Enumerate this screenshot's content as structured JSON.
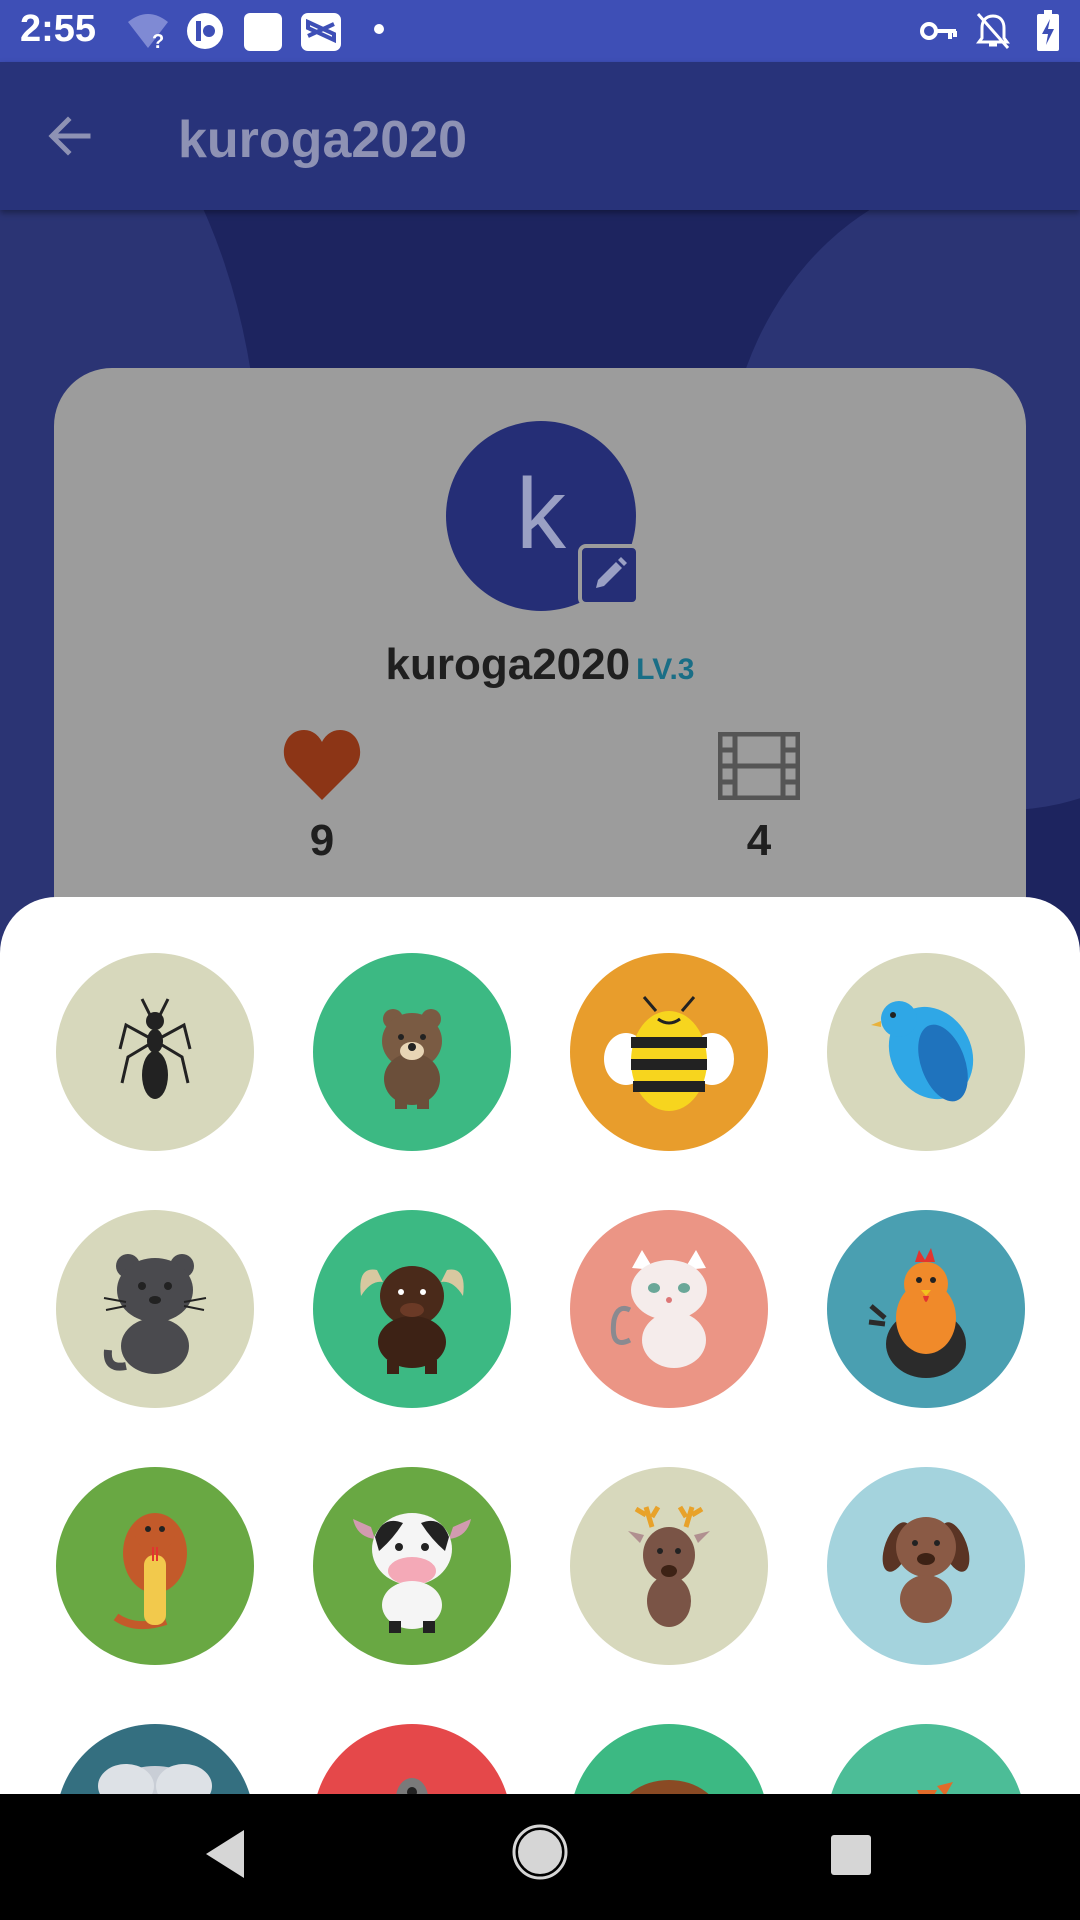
{
  "status_bar": {
    "time": "2:55",
    "left_icons": [
      "wifi-question-icon",
      "app-notification-icon",
      "blank-notification-icon",
      "capcut-notification-icon",
      "dot-icon"
    ],
    "right_icons": [
      "vpn-key-icon",
      "notifications-off-icon",
      "battery-charging-icon"
    ]
  },
  "app_bar": {
    "back_icon": "arrow-back-icon",
    "title": "kuroga2020"
  },
  "profile": {
    "avatar_letter": "k",
    "edit_icon": "pencil-icon",
    "username": "kuroga2020",
    "level": "LV.3",
    "likes": "9",
    "videos": "4",
    "likes_icon": "heart-icon",
    "videos_icon": "film-strip-icon"
  },
  "avatar_choices": [
    {
      "animal": "ant",
      "bg": "#d7d8bc"
    },
    {
      "animal": "bear",
      "bg": "#3cb983"
    },
    {
      "animal": "bee",
      "bg": "#e89d2c"
    },
    {
      "animal": "bird",
      "bg": "#d7d8bc"
    },
    {
      "animal": "panther",
      "bg": "#d7d8bc"
    },
    {
      "animal": "buffalo",
      "bg": "#3cb983"
    },
    {
      "animal": "cat",
      "bg": "#eb9585"
    },
    {
      "animal": "rooster",
      "bg": "#4a9fb1"
    },
    {
      "animal": "cobra",
      "bg": "#69a843"
    },
    {
      "animal": "cow",
      "bg": "#69a843"
    },
    {
      "animal": "deer",
      "bg": "#d7d8bc"
    },
    {
      "animal": "dog",
      "bg": "#a4d3dd"
    },
    {
      "animal": "elephant",
      "bg": "#346f80"
    },
    {
      "animal": "eagle",
      "bg": "#e5484a"
    },
    {
      "animal": "monkey",
      "bg": "#3cb983"
    },
    {
      "animal": "fox",
      "bg": "#4cbd97"
    }
  ],
  "nav_bar": {
    "back": "nav-back-icon",
    "home": "nav-home-icon",
    "recents": "nav-recents-icon"
  }
}
